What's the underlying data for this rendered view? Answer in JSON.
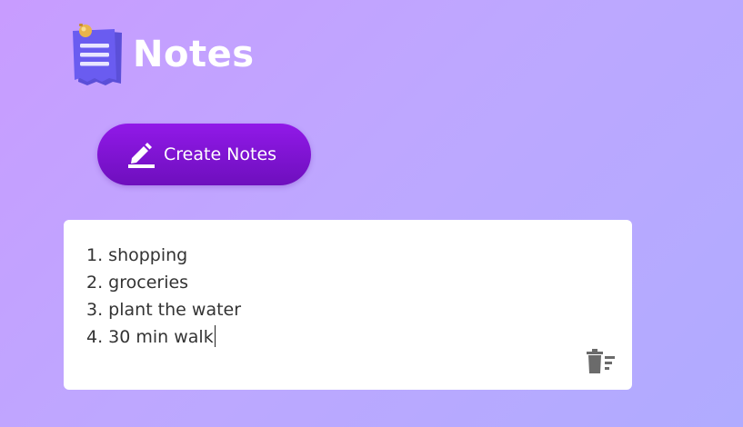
{
  "header": {
    "title": "Notes",
    "logo_icon": "notepad-pin-icon"
  },
  "toolbar": {
    "create_label": "Create Notes",
    "create_icon": "pencil-edit-icon",
    "accent_color": "#7a12cc"
  },
  "note": {
    "lines": [
      "1. shopping",
      "2. groceries",
      "3. plant the water",
      "4. 30 min walk"
    ],
    "delete_icon": "trash-icon"
  }
}
